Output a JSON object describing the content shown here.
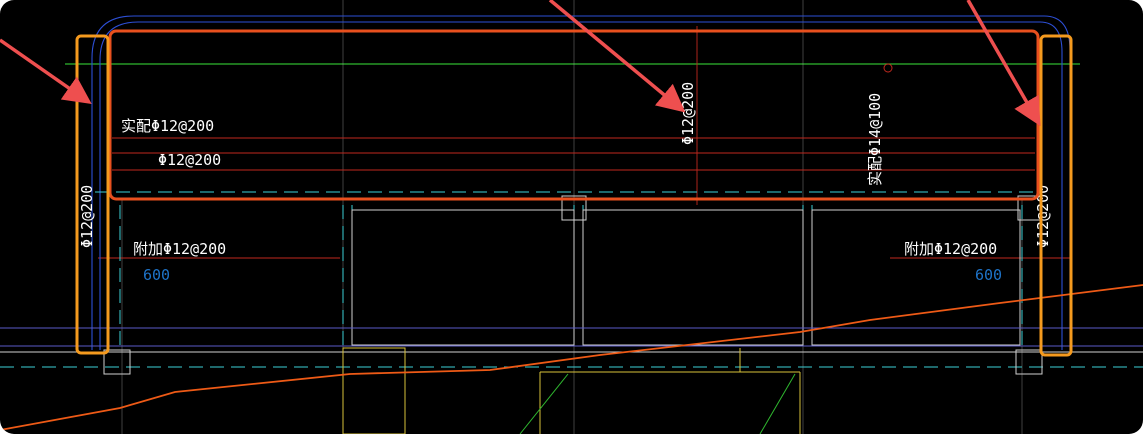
{
  "drawing": {
    "labels": {
      "top_left_extra": "实配Φ12@200",
      "top_left_main": "Φ12@200",
      "top_mid_vertical": "Φ12@200",
      "top_right_vertical": "实配Φ14@100",
      "left_wall_vertical": "Φ12@200",
      "right_wall_vertical": "Φ12@200",
      "left_add": "附加Φ12@200",
      "right_add": "附加Φ12@200",
      "left_dim": "600",
      "right_dim": "600"
    },
    "colors": {
      "background": "#000000",
      "highlight_box_red": "#e8501e",
      "highlight_box_orange": "#f59a1e",
      "arrow": "#ee4f4f",
      "annotation_text": "#ffffff",
      "dimension_text": "#1e73c8"
    }
  }
}
